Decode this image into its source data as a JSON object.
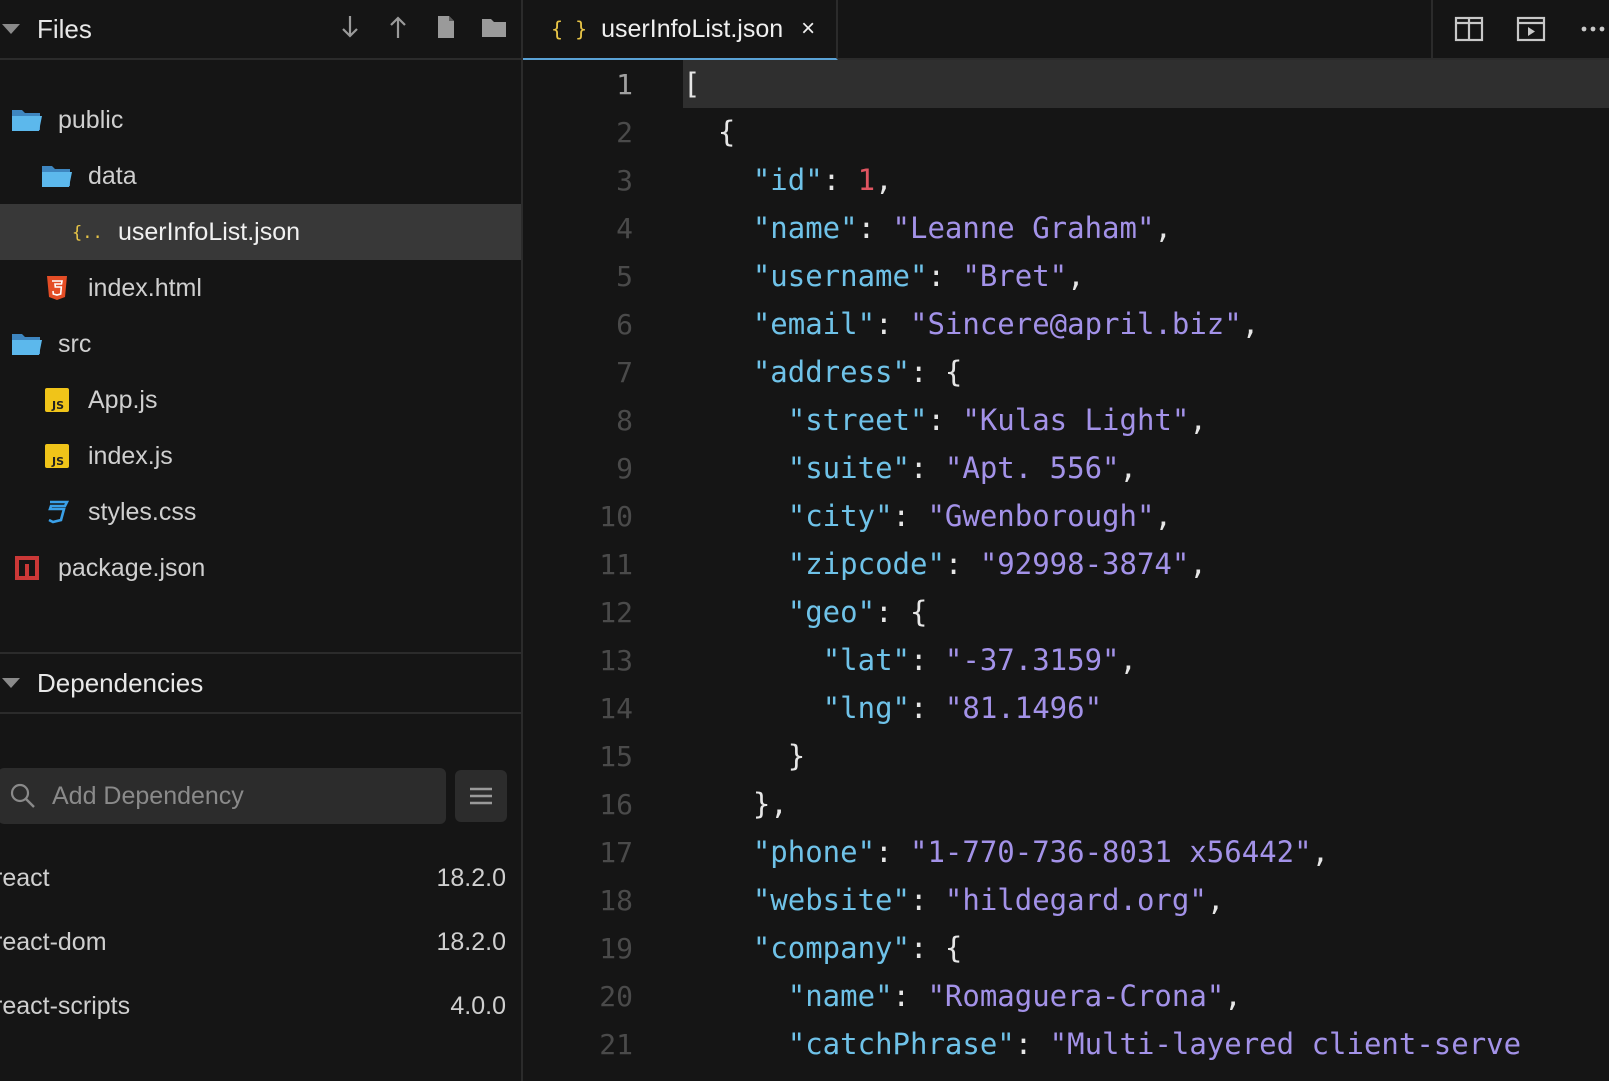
{
  "files": {
    "title": "Files",
    "actions": [
      "download-icon",
      "upload-icon",
      "new-file-icon",
      "new-folder-icon"
    ],
    "tree": [
      {
        "label": "public",
        "icon": "folder-icon",
        "depth": 0
      },
      {
        "label": "data",
        "icon": "folder-icon",
        "depth": 1
      },
      {
        "label": "userInfoList.json",
        "icon": "json-file-icon",
        "depth": 2,
        "selected": true
      },
      {
        "label": "index.html",
        "icon": "html-file-icon",
        "depth": 1
      },
      {
        "label": "src",
        "icon": "folder-icon",
        "depth": 0
      },
      {
        "label": "App.js",
        "icon": "js-file-icon",
        "depth": 1
      },
      {
        "label": "index.js",
        "icon": "js-file-icon",
        "depth": 1
      },
      {
        "label": "styles.css",
        "icon": "css-file-icon",
        "depth": 1
      },
      {
        "label": "package.json",
        "icon": "npm-file-icon",
        "depth": 0
      }
    ]
  },
  "dependencies": {
    "title": "Dependencies",
    "search_placeholder": "Add Dependency",
    "items": [
      {
        "name": "react",
        "version": "18.2.0"
      },
      {
        "name": "react-dom",
        "version": "18.2.0"
      },
      {
        "name": "react-scripts",
        "version": "4.0.0"
      }
    ]
  },
  "editor": {
    "tab": {
      "icon_text": "{ }",
      "label": "userInfoList.json",
      "close": "×"
    },
    "actions": [
      "split-view-icon",
      "preview-icon",
      "more-icon"
    ],
    "current_line": 1,
    "lines": [
      [
        [
          "p",
          "["
        ]
      ],
      [
        [
          "p",
          "  {"
        ]
      ],
      [
        [
          "p",
          "    "
        ],
        [
          "k",
          "\"id\""
        ],
        [
          "p",
          ": "
        ],
        [
          "n",
          "1"
        ],
        [
          "p",
          ","
        ]
      ],
      [
        [
          "p",
          "    "
        ],
        [
          "k",
          "\"name\""
        ],
        [
          "p",
          ": "
        ],
        [
          "s",
          "\"Leanne Graham\""
        ],
        [
          "p",
          ","
        ]
      ],
      [
        [
          "p",
          "    "
        ],
        [
          "k",
          "\"username\""
        ],
        [
          "p",
          ": "
        ],
        [
          "s",
          "\"Bret\""
        ],
        [
          "p",
          ","
        ]
      ],
      [
        [
          "p",
          "    "
        ],
        [
          "k",
          "\"email\""
        ],
        [
          "p",
          ": "
        ],
        [
          "s",
          "\"Sincere@april.biz\""
        ],
        [
          "p",
          ","
        ]
      ],
      [
        [
          "p",
          "    "
        ],
        [
          "k",
          "\"address\""
        ],
        [
          "p",
          ": {"
        ]
      ],
      [
        [
          "p",
          "      "
        ],
        [
          "k",
          "\"street\""
        ],
        [
          "p",
          ": "
        ],
        [
          "s",
          "\"Kulas Light\""
        ],
        [
          "p",
          ","
        ]
      ],
      [
        [
          "p",
          "      "
        ],
        [
          "k",
          "\"suite\""
        ],
        [
          "p",
          ": "
        ],
        [
          "s",
          "\"Apt. 556\""
        ],
        [
          "p",
          ","
        ]
      ],
      [
        [
          "p",
          "      "
        ],
        [
          "k",
          "\"city\""
        ],
        [
          "p",
          ": "
        ],
        [
          "s",
          "\"Gwenborough\""
        ],
        [
          "p",
          ","
        ]
      ],
      [
        [
          "p",
          "      "
        ],
        [
          "k",
          "\"zipcode\""
        ],
        [
          "p",
          ": "
        ],
        [
          "s",
          "\"92998-3874\""
        ],
        [
          "p",
          ","
        ]
      ],
      [
        [
          "p",
          "      "
        ],
        [
          "k",
          "\"geo\""
        ],
        [
          "p",
          ": {"
        ]
      ],
      [
        [
          "p",
          "        "
        ],
        [
          "k",
          "\"lat\""
        ],
        [
          "p",
          ": "
        ],
        [
          "s",
          "\"-37.3159\""
        ],
        [
          "p",
          ","
        ]
      ],
      [
        [
          "p",
          "        "
        ],
        [
          "k",
          "\"lng\""
        ],
        [
          "p",
          ": "
        ],
        [
          "s",
          "\"81.1496\""
        ]
      ],
      [
        [
          "p",
          "      }"
        ]
      ],
      [
        [
          "p",
          "    },"
        ]
      ],
      [
        [
          "p",
          "    "
        ],
        [
          "k",
          "\"phone\""
        ],
        [
          "p",
          ": "
        ],
        [
          "s",
          "\"1-770-736-8031 x56442\""
        ],
        [
          "p",
          ","
        ]
      ],
      [
        [
          "p",
          "    "
        ],
        [
          "k",
          "\"website\""
        ],
        [
          "p",
          ": "
        ],
        [
          "s",
          "\"hildegard.org\""
        ],
        [
          "p",
          ","
        ]
      ],
      [
        [
          "p",
          "    "
        ],
        [
          "k",
          "\"company\""
        ],
        [
          "p",
          ": {"
        ]
      ],
      [
        [
          "p",
          "      "
        ],
        [
          "k",
          "\"name\""
        ],
        [
          "p",
          ": "
        ],
        [
          "s",
          "\"Romaguera-Crona\""
        ],
        [
          "p",
          ","
        ]
      ],
      [
        [
          "p",
          "      "
        ],
        [
          "k",
          "\"catchPhrase\""
        ],
        [
          "p",
          ": "
        ],
        [
          "s",
          "\"Multi-layered client-serve"
        ]
      ]
    ]
  },
  "colors": {
    "key": "#6fc2e8",
    "string": "#a392e8",
    "number": "#e05561",
    "accent": "#5aa2d6"
  }
}
